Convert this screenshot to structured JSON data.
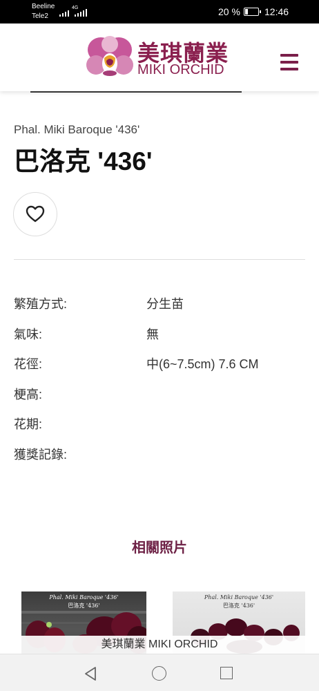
{
  "status_bar": {
    "carrier1": "Beeline",
    "carrier2": "Tele2",
    "network": "4G",
    "battery_percent": "20 %",
    "battery_level": 0.2,
    "time": "12:46"
  },
  "header": {
    "logo_cn": "美琪蘭業",
    "logo_en": "MIKI ORCHID",
    "brand_color": "#8a1f4e",
    "menu_icon": "hamburger-icon"
  },
  "product": {
    "subtitle": "Phal. Miki Baroque '436'",
    "title": "巴洛克 '436'",
    "favorite_icon": "heart-icon"
  },
  "attributes": [
    {
      "label": "繁殖方式:",
      "value": "分生苗"
    },
    {
      "label": "氣味:",
      "value": "無"
    },
    {
      "label": "花徑:",
      "value": "中(6~7.5cm)  7.6 CM"
    },
    {
      "label": "梗高:",
      "value": ""
    },
    {
      "label": "花期:",
      "value": ""
    },
    {
      "label": "獲獎記錄:",
      "value": ""
    }
  ],
  "related": {
    "title": "相關照片",
    "photos": [
      {
        "caption1": "Phal. Miki Baroque '436'",
        "caption2": "巴洛克 '436'"
      },
      {
        "caption1": "Phal. Miki Baroque '436'",
        "caption2": "巴洛克 '436'"
      }
    ]
  },
  "footer": {
    "text": "美琪蘭業 MIKI ORCHID"
  },
  "nav_bar": {
    "back_icon": "triangle-back-icon",
    "home_icon": "circle-home-icon",
    "recent_icon": "square-recents-icon"
  }
}
